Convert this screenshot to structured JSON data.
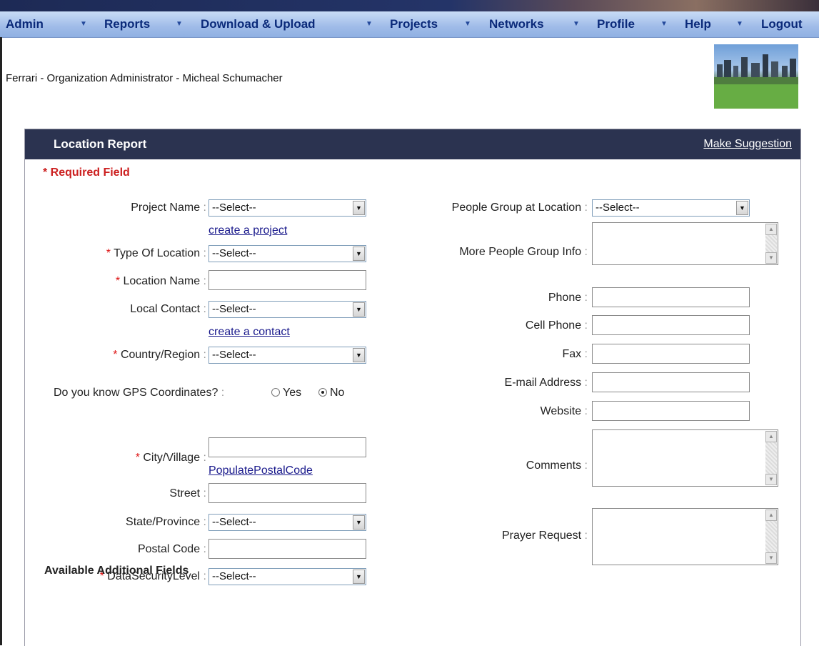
{
  "nav": {
    "items": [
      "Admin",
      "Reports",
      "Download & Upload",
      "Projects",
      "Networks",
      "Profile",
      "Help",
      "Logout"
    ]
  },
  "header": {
    "user_line": "Ferrari - Organization Administrator - Micheal Schumacher"
  },
  "panel": {
    "title": "Location Report",
    "suggest_link": "Make Suggestion",
    "required_note": "* Required Field",
    "additional_fields": "Available Additional Fields"
  },
  "form": {
    "project_name": {
      "label": "Project Name",
      "value": "--Select--"
    },
    "create_project": "create a project",
    "type_of_location": {
      "label": "Type Of Location",
      "value": "--Select--"
    },
    "location_name": {
      "label": "Location Name"
    },
    "local_contact": {
      "label": "Local Contact",
      "value": "--Select--"
    },
    "create_contact": "create a contact",
    "country_region": {
      "label": "Country/Region",
      "value": "--Select--"
    },
    "gps": {
      "question": "Do you know GPS Coordinates?",
      "yes": "Yes",
      "no": "No",
      "selected": "No"
    },
    "city_village": {
      "label": "City/Village"
    },
    "populate_postal": "PopulatePostalCode",
    "street": {
      "label": "Street"
    },
    "state_province": {
      "label": "State/Province",
      "value": "--Select--"
    },
    "postal_code": {
      "label": "Postal Code"
    },
    "data_security": {
      "label": "DataSecurityLevel",
      "value": "--Select--"
    },
    "people_group": {
      "label": "People Group at Location",
      "value": "--Select--"
    },
    "more_people_info": {
      "label": "More People Group Info"
    },
    "phone": {
      "label": "Phone"
    },
    "cell_phone": {
      "label": "Cell Phone"
    },
    "fax": {
      "label": "Fax"
    },
    "email": {
      "label": "E-mail Address"
    },
    "website": {
      "label": "Website"
    },
    "comments": {
      "label": "Comments"
    },
    "prayer_request": {
      "label": "Prayer Request"
    }
  }
}
